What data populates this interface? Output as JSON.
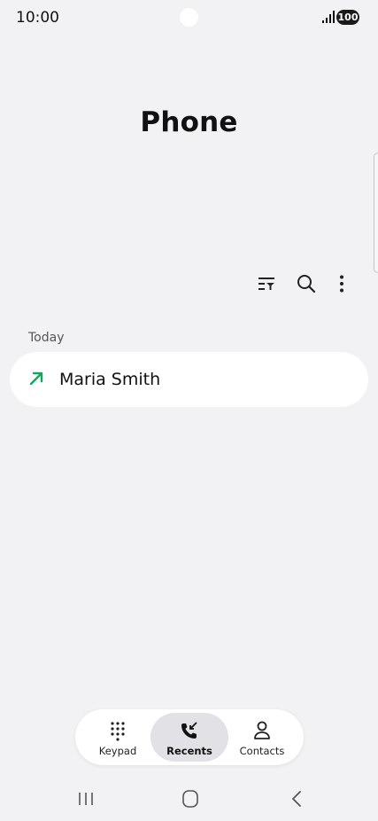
{
  "status_bar": {
    "time": "10:00",
    "battery": "100",
    "icons": [
      "signal-icon",
      "battery-icon"
    ]
  },
  "app": {
    "title": "Phone"
  },
  "toolbar": {
    "icons": [
      "filter-icon",
      "search-icon",
      "more-options-icon"
    ]
  },
  "recents": {
    "section_header": "Today",
    "calls": [
      {
        "name": "Maria Smith",
        "type": "outgoing",
        "icon": "outgoing-call-arrow-icon",
        "icon_color": "#1aa35b"
      }
    ]
  },
  "bottom_nav": {
    "items": [
      {
        "label": "Keypad",
        "icon": "keypad-icon",
        "active": false
      },
      {
        "label": "Recents",
        "icon": "recents-icon",
        "active": true
      },
      {
        "label": "Contacts",
        "icon": "contacts-icon",
        "active": false
      }
    ]
  },
  "system_nav": {
    "icons": [
      "recent-apps-icon",
      "home-icon",
      "back-icon"
    ]
  },
  "colors": {
    "background": "#f2f2f4",
    "card": "#ffffff",
    "accent_green": "#1aa35b",
    "active_tab": "#e2e2e6"
  }
}
